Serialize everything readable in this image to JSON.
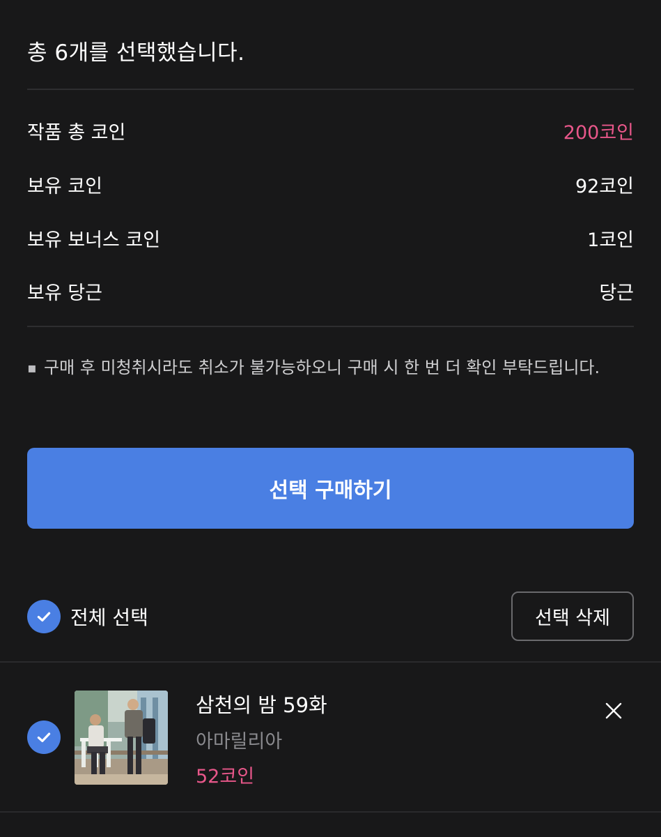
{
  "summary": {
    "title": "총 6개를 선택했습니다.",
    "rows": [
      {
        "label": "작품 총 코인",
        "value": "200코인"
      },
      {
        "label": "보유 코인",
        "value": "92코인"
      },
      {
        "label": "보유 보너스 코인",
        "value": "1코인"
      },
      {
        "label": "보유 당근",
        "value": "당근"
      }
    ]
  },
  "notice": {
    "bullet": "▪",
    "text": "구매 후 미청취시라도 취소가 불가능하오니 구매 시 한 번 더 확인 부탁드립니다."
  },
  "buy_button": {
    "label": "선택 구매하기"
  },
  "toolbar": {
    "select_all_label": "전체 선택",
    "delete_label": "선택 삭제"
  },
  "items": [
    {
      "title": "삼천의 밤 59화",
      "author": "아마릴리아",
      "price": "52코인",
      "selected": true
    }
  ],
  "colors": {
    "background": "#181819",
    "accent_blue": "#4a7fe3",
    "price_pink": "#e8578a"
  },
  "icons": {
    "check": "check-icon",
    "close": "close-icon"
  }
}
